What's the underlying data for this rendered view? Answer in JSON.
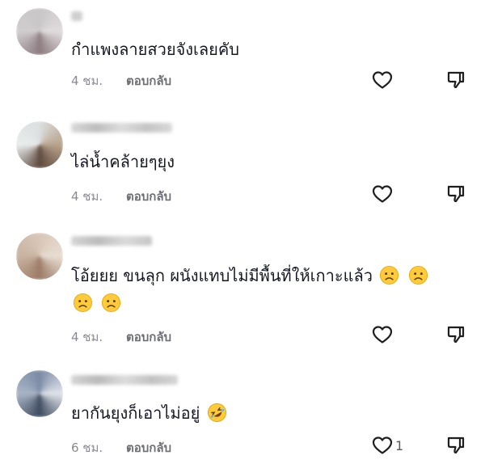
{
  "comments": [
    {
      "user_redacted": true,
      "text": "กำแพงลายสวยจังเลยคับ",
      "time": "4 ชม.",
      "reply_label": "ตอบกลับ",
      "like_count": "",
      "avatar_colors": [
        "#c9c6c8",
        "#e0dcdd",
        "#8d7c80",
        "#d1cdcf"
      ]
    },
    {
      "user_redacted": true,
      "text": "ไล่น้ำคล้ายๆยุง",
      "time": "4 ชม.",
      "reply_label": "ตอบกลับ",
      "like_count": "",
      "avatar_colors": [
        "#dcdfe0",
        "#b8a48c",
        "#5f4a3e",
        "#e9ecec"
      ]
    },
    {
      "user_redacted": true,
      "text": "โอ้ยยย ขนลุก ผนังแทบไม่มีพื้นที่ให้เกาะแล้ว",
      "emoji_line": "frowning-face-icon x4",
      "time": "4 ชม.",
      "reply_label": "ตอบกลับ",
      "like_count": "",
      "avatar_colors": [
        "#d8c7b8",
        "#e8ddd2",
        "#9c7b67",
        "#c9b3a1"
      ]
    },
    {
      "user_redacted": true,
      "text": "ยากันยุงก็เอาไม่อยู่",
      "emoji": "rolling-on-floor-laughing-icon",
      "time": "6 ชม.",
      "reply_label": "ตอบกลับ",
      "like_count": "1",
      "avatar_colors": [
        "#7b8aa5",
        "#dfe3ea",
        "#3f4b60",
        "#a9b4c6"
      ]
    }
  ],
  "colors": {
    "text": "#161823",
    "meta": "#8a8b91",
    "icon": "#1f1f1f"
  }
}
